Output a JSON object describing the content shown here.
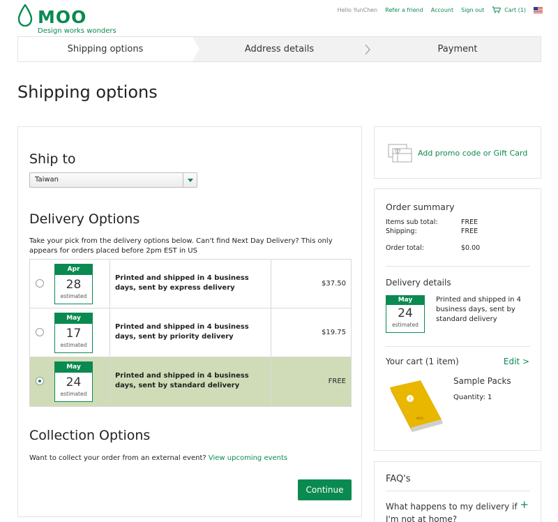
{
  "header": {
    "brand": "MOO",
    "tagline": "Design works wonders",
    "nav": {
      "hello": "Hello YunChen",
      "refer": "Refer a friend",
      "account": "Account",
      "signout": "Sign out",
      "cart": "Cart (1)"
    }
  },
  "steps": [
    "Shipping options",
    "Address details",
    "Payment"
  ],
  "page_title": "Shipping options",
  "ship_to": {
    "heading": "Ship to",
    "selected": "Taiwan"
  },
  "delivery": {
    "heading": "Delivery Options",
    "intro": "Take your pick from the delivery options below. Can't find Next Day Delivery? This only appears for orders placed before 2pm EST in US",
    "options": [
      {
        "month": "Apr",
        "day": "28",
        "est": "estimated",
        "desc": "Printed and shipped in 4 business days, sent by express delivery",
        "price": "$37.50"
      },
      {
        "month": "May",
        "day": "17",
        "est": "estimated",
        "desc": "Printed and shipped in 4 business days, sent by priority delivery",
        "price": "$19.75"
      },
      {
        "month": "May",
        "day": "24",
        "est": "estimated",
        "desc": "Printed and shipped in 4 business days, sent by standard delivery",
        "price": "FREE"
      }
    ]
  },
  "collection": {
    "heading": "Collection Options",
    "text": "Want to collect your order from an external event?",
    "link": "View upcoming events"
  },
  "continue_label": "Continue",
  "promo_label": "Add promo code or Gift Card",
  "summary": {
    "title": "Order summary",
    "subtotal_label": "Items sub total:",
    "subtotal_value": "FREE",
    "shipping_label": "Shipping:",
    "shipping_value": "FREE",
    "total_label": "Order total:",
    "total_value": "$0.00",
    "delivery_title": "Delivery details",
    "delivery_month": "May",
    "delivery_day": "24",
    "delivery_est": "estimated",
    "delivery_desc": "Printed and shipped in 4 business days, sent by standard delivery",
    "cart_title": "Your cart (1 item)",
    "edit_label": "Edit >",
    "product_name": "Sample Packs",
    "product_qty": "Quantity: 1"
  },
  "faq": {
    "title": "FAQ's",
    "question": "What happens to my delivery if I'm not at home?"
  },
  "colors": {
    "brand_green": "#0a8a50",
    "selected_row": "#cfdcb7"
  }
}
